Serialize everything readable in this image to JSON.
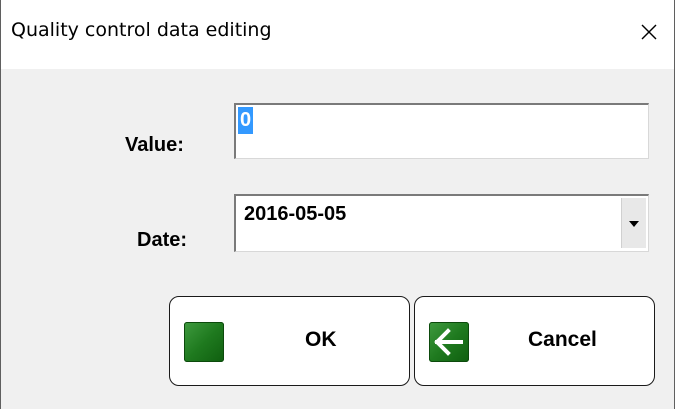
{
  "window": {
    "title": "Quality control data editing",
    "close_icon": "close-icon"
  },
  "form": {
    "value_label": "Value:",
    "value": "0",
    "date_label": "Date:",
    "date_value": "2016-05-05",
    "date_dropdown_icon": "chevron-down-icon"
  },
  "buttons": {
    "ok_label": "OK",
    "ok_icon": "green-square-icon",
    "cancel_label": "Cancel",
    "cancel_icon": "arrow-left-icon"
  },
  "colors": {
    "icon_green": "#1f7a1f",
    "selection_blue": "#3399ff"
  }
}
